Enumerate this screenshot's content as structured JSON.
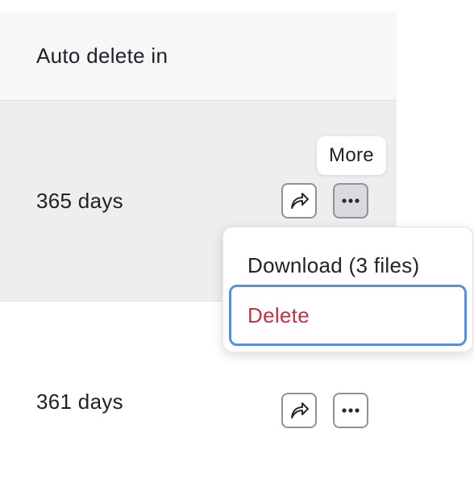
{
  "table": {
    "header": {
      "auto_delete_label": "Auto delete in"
    },
    "rows": [
      {
        "auto_delete": "365 days",
        "share_icon": "share-forward-icon",
        "more_icon": "more-horizontal-icon"
      },
      {
        "auto_delete": "361 days",
        "share_icon": "share-forward-icon",
        "more_icon": "more-horizontal-icon"
      }
    ]
  },
  "tooltip": {
    "text": "More"
  },
  "menu": {
    "items": [
      {
        "label": "Download (3 files)",
        "color": "#222226"
      },
      {
        "label": "Delete",
        "color": "#c8313f"
      }
    ],
    "focus_ring_color": "#5b8fdc"
  },
  "colors": {
    "header_bg": "#f6f7f9",
    "hover_row_bg": "#eeeeef",
    "danger": "#c8313f",
    "focus": "#5b8fdc"
  }
}
